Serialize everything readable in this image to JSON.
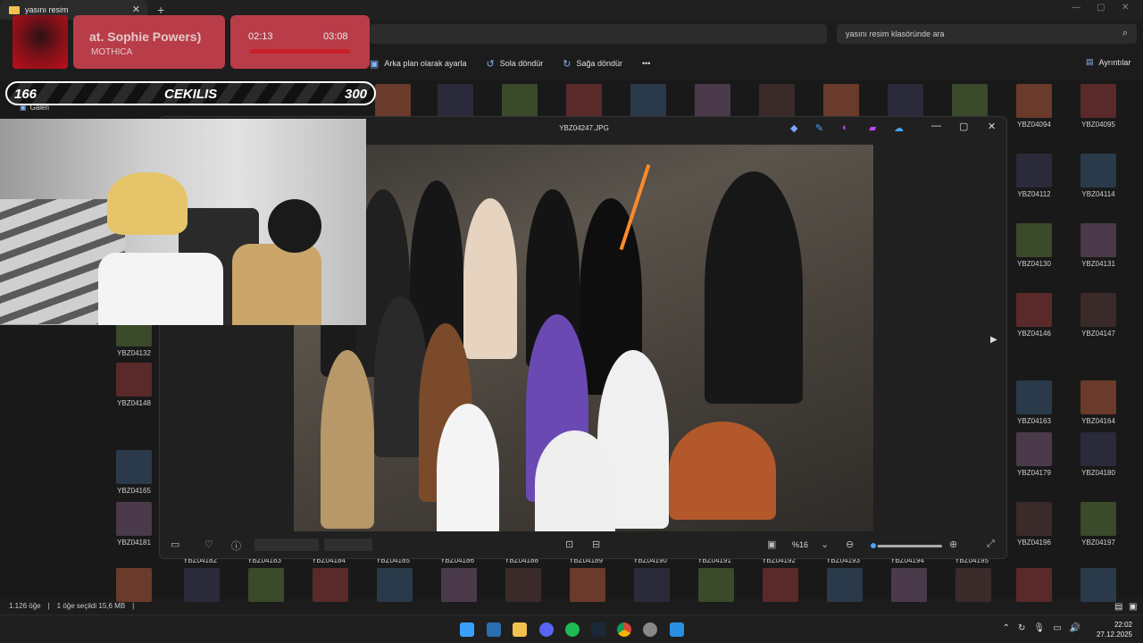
{
  "tab": {
    "title": "yasını resim"
  },
  "search": {
    "placeholder": "yasını resim klasöründe ara"
  },
  "sidebar": {
    "item": "Galeri"
  },
  "toolbar": {
    "set_background": "Arka plan olarak ayarla",
    "rotate_left": "Sola döndür",
    "rotate_right": "Sağa döndür",
    "more": "•••",
    "details": "Ayrıntılar"
  },
  "overlay": {
    "song_title": "at. Sophie Powers)",
    "artist": "MOTHICA",
    "time_elapsed": "02:13",
    "time_total": "03:08",
    "giveaway_left": "166",
    "giveaway_title": "CEKILIS",
    "giveaway_right": "300"
  },
  "viewer": {
    "filename": "YBZ04247.JPG",
    "zoom_label": "%16",
    "zoom_level": 0.02
  },
  "thumbnails": {
    "right_col": [
      {
        "a": "YBZ04094",
        "b": "YBZ04095"
      },
      {
        "a": "YBZ04112",
        "b": "YBZ04114"
      },
      {
        "a": "YBZ04130",
        "b": "YBZ04131"
      },
      {
        "a": "YBZ04146",
        "b": "YBZ04147"
      },
      {
        "a": "YBZ04163",
        "b": "YBZ04164"
      },
      {
        "a": "YBZ04179",
        "b": "YBZ04180"
      },
      {
        "a": "YBZ04196",
        "b": "YBZ04197"
      }
    ],
    "left_col": [
      "YBZ04132",
      "YBZ04148",
      "YBZ04165",
      "YBZ04181"
    ],
    "bottom_row": [
      "YBZ04182",
      "YBZ04183",
      "YBZ04184",
      "YBZ04185",
      "YBZ04186",
      "YBZ04188",
      "YBZ04189",
      "YBZ04190",
      "YBZ04191",
      "YBZ04192",
      "YBZ04193",
      "YBZ04194",
      "YBZ04195"
    ]
  },
  "status": {
    "count": "1.126 öğe",
    "selected": "1 öğe seçildi  15,6 MB"
  },
  "clock": {
    "time": "22:02",
    "date": "27.12.2025"
  }
}
